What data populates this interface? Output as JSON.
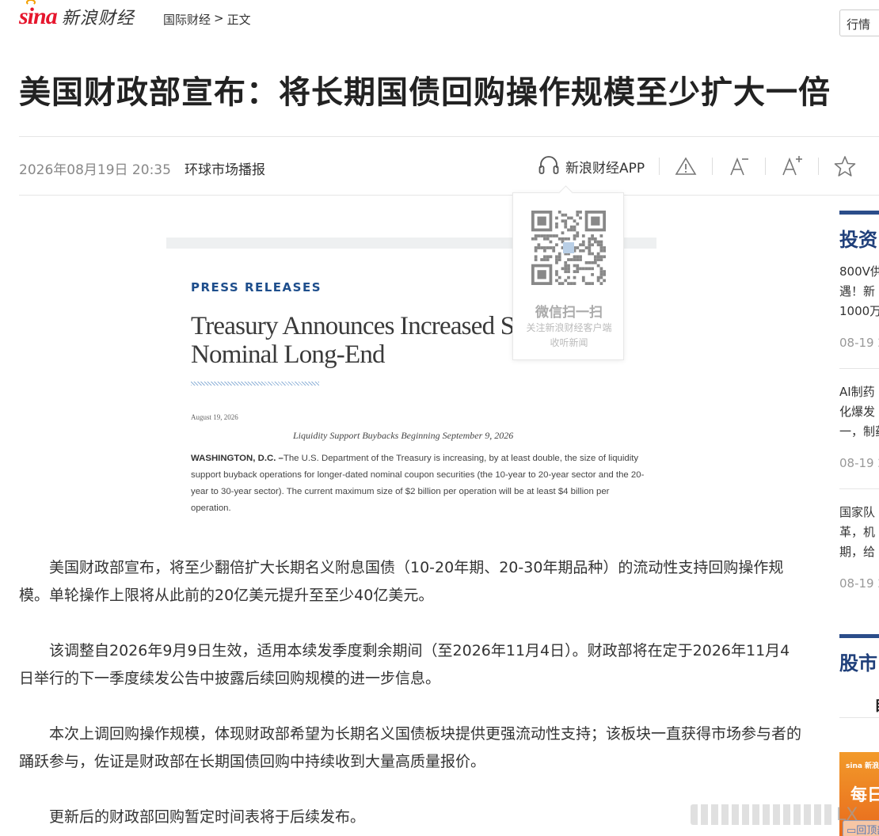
{
  "header": {
    "logo_brand": "sina",
    "logo_text": "新浪财经",
    "breadcrumb": {
      "section": "国际财经",
      "separator": ">",
      "current": "正文"
    },
    "quote_button": "行情"
  },
  "article": {
    "title": "美国财政部宣布：将长期国债回购操作规模至少扩大一倍",
    "date": "2026年08月19日 20:35",
    "source": "环球市场播报",
    "tools": {
      "app_label": "新浪财经APP",
      "icons": [
        "headphones-icon",
        "report-icon",
        "font-decrease-icon",
        "font-increase-icon",
        "favorite-star-icon"
      ]
    },
    "qr_popup": {
      "title": "微信扫一扫",
      "line1": "关注新浪财经客户端",
      "line2": "收听新闻"
    },
    "press_image": {
      "kicker": "PRESS RELEASES",
      "heading_line1": "Treasury Announces Increased Sizes of",
      "heading_line2": "Nominal Long-End",
      "date": "August 19, 2026",
      "subhead": "Liquidity Support Buybacks Beginning September 9, 2026",
      "dateline": "WASHINGTON, D.C. –",
      "body": "The U.S. Department of the Treasury is increasing, by at least double, the size of liquidity support buyback operations for longer-dated nominal coupon securities (the 10-year to 20-year sector and the 20-year to 30-year sector).  The current maximum size of $2 billion per operation will be at least $4 billion per operation."
    },
    "paragraphs": [
      "美国财政部宣布，将至少翻倍扩大长期名义附息国债（10-20年期、20-30年期品种）的流动性支持回购操作规模。单轮操作上限将从此前的20亿美元提升至至少40亿美元。",
      "该调整自2026年9月9日生效，适用本续发季度剩余期间（至2026年11月4日）。财政部将在定于2026年11月4日举行的下一季度续发公告中披露后续回购规模的进一步信息。",
      "本次上调回购操作规模，体现财政部希望为长期名义国债板块提供更强流动性支持；该板块一直获得市场参与者的踊跃参与，佐证是财政部在长期国债回购中持续收到大量高质量报价。",
      "更新后的财政部回购暂定时间表将于后续发布。"
    ]
  },
  "sidebar": {
    "section1_title": "投资",
    "items": [
      {
        "lines": [
          "800V供",
          "遇！新",
          "1000万"
        ],
        "time": "08-19 2"
      },
      {
        "lines": [
          "AI制药",
          "化爆发",
          "一，制药"
        ],
        "time": "08-19 2"
      },
      {
        "lines": [
          "国家队",
          "革，机",
          "期，给"
        ],
        "time": "08-19 2"
      }
    ],
    "section2_title": "股市",
    "tab_label": "自",
    "ad": {
      "logo": "sina 新浪财经",
      "text": "每日"
    }
  },
  "overlay": {
    "watermark_text": "LX",
    "back_to_top": "回顶部"
  },
  "colors": {
    "brand_red": "#e6162d",
    "sidebar_blue": "#1f3f7a",
    "press_kicker_blue": "#1e4e8c",
    "ad_orange": "#f29a2a"
  }
}
